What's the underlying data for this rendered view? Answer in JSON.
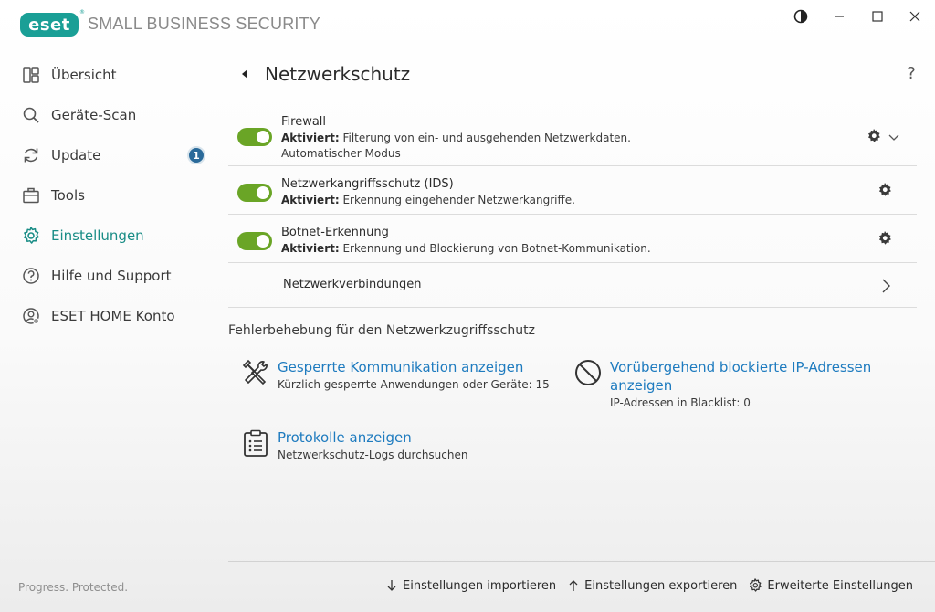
{
  "app": {
    "logo_text": "eset",
    "logo_reg": "®",
    "product_name": "SMALL BUSINESS SECURITY",
    "brand_color": "#1a9f96",
    "accent_color": "#6aa526",
    "link_color": "#1e7bbf"
  },
  "window_controls": {
    "theme_icon": "contrast-icon",
    "minimize_icon": "minimize-icon",
    "maximize_icon": "maximize-icon",
    "close_icon": "close-icon"
  },
  "sidebar": {
    "items": [
      {
        "label": "Übersicht",
        "icon": "overview-icon"
      },
      {
        "label": "Geräte-Scan",
        "icon": "search-icon"
      },
      {
        "label": "Update",
        "icon": "refresh-icon",
        "badge": "1"
      },
      {
        "label": "Tools",
        "icon": "briefcase-icon"
      },
      {
        "label": "Einstellungen",
        "icon": "gear-icon",
        "active": true
      },
      {
        "label": "Hilfe und Support",
        "icon": "help-icon"
      },
      {
        "label": "ESET HOME Konto",
        "icon": "account-icon"
      }
    ]
  },
  "page": {
    "title": "Netzwerkschutz",
    "help": "?"
  },
  "settings": {
    "firewall": {
      "title": "Firewall",
      "status": "Aktiviert:",
      "desc": " Filterung von ein- und ausgehenden Netzwerkdaten.",
      "extra": "Automatischer Modus",
      "enabled": true
    },
    "ids": {
      "title": "Netzwerkangriffsschutz (IDS)",
      "status": "Aktiviert:",
      "desc": " Erkennung eingehender Netzwerkangriffe.",
      "enabled": true
    },
    "botnet": {
      "title": "Botnet-Erkennung",
      "status": "Aktiviert:",
      "desc": " Erkennung und Blockierung von Botnet-Kommunikation.",
      "enabled": true
    },
    "connections": {
      "label": "Netzwerkverbindungen"
    }
  },
  "troubleshooting": {
    "heading": "Fehlerbehebung für den Netzwerkzugriffsschutz",
    "blocked_comm": {
      "title": "Gesperrte Kommunikation anzeigen",
      "sub": "Kürzlich gesperrte Anwendungen oder Geräte: 15"
    },
    "blocked_ips": {
      "title_line1": "Vorübergehend blockierte IP-Adressen",
      "title_line2": "anzeigen",
      "sub": "IP-Adressen in Blacklist: 0"
    },
    "logs": {
      "title": "Protokolle anzeigen",
      "sub": "Netzwerkschutz-Logs durchsuchen"
    }
  },
  "footer": {
    "status": "Progress. Protected.",
    "import": "Einstellungen importieren",
    "export": "Einstellungen exportieren",
    "advanced": "Erweiterte Einstellungen"
  }
}
